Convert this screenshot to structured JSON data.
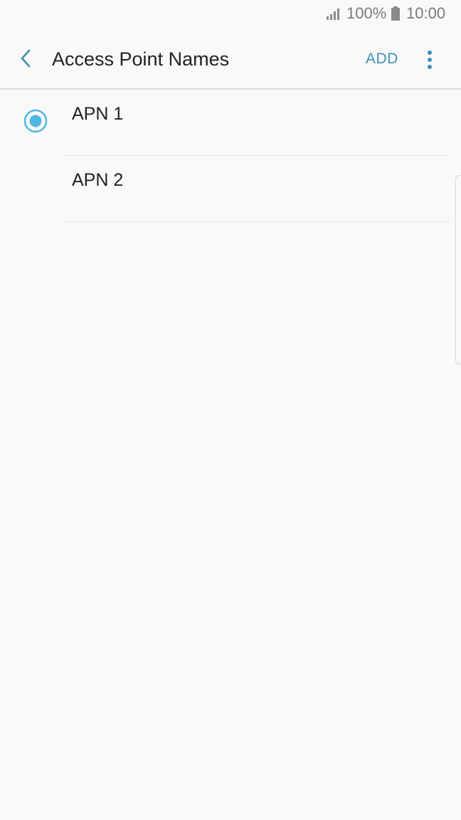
{
  "status_bar": {
    "signal_icon": "signal-bars-icon",
    "battery_percent": "100%",
    "battery_icon": "battery-icon",
    "time": "10:00"
  },
  "toolbar": {
    "back_icon": "chevron-left-icon",
    "title": "Access Point Names",
    "add_label": "ADD",
    "more_icon": "more-vertical-icon"
  },
  "apn_list": {
    "items": [
      {
        "label": "APN 1",
        "selected": true
      },
      {
        "label": "APN 2",
        "selected": false
      }
    ]
  },
  "colors": {
    "accent": "#3d8fb4",
    "radio": "#4fb8e2",
    "background": "#f9f9f9",
    "text": "#222222",
    "status_text": "#7a7a7a"
  }
}
